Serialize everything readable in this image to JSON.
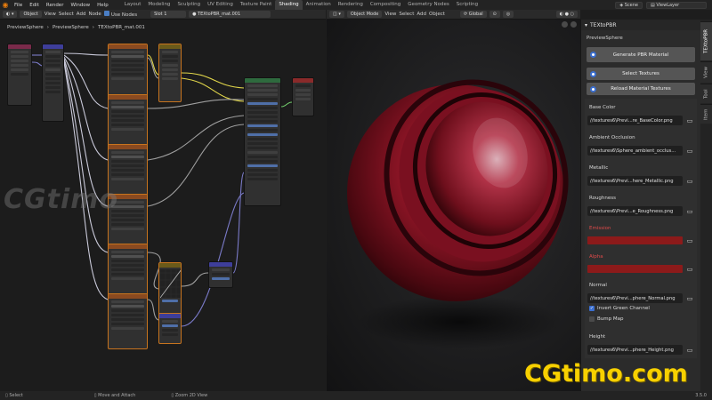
{
  "menu": [
    "File",
    "Edit",
    "Render",
    "Window",
    "Help"
  ],
  "workspaces": [
    "Layout",
    "Modeling",
    "Sculpting",
    "UV Editing",
    "Texture Paint",
    "Shading",
    "Animation",
    "Rendering",
    "Compositing",
    "Geometry Nodes",
    "Scripting"
  ],
  "active_workspace": "Shading",
  "scene": "Scene",
  "view_layer": "ViewLayer",
  "node_header": {
    "mode": "Object",
    "menus": [
      "View",
      "Select",
      "Add",
      "Node"
    ],
    "use_nodes": "Use Nodes",
    "slot": "Slot 1",
    "material": "TEXtoPBR_mat.001"
  },
  "breadcrumb": [
    "PreviewSphere",
    "PreviewSphere",
    "TEXtoPBR_mat.001"
  ],
  "viewport_header": {
    "mode": "Object Mode",
    "menus": [
      "View",
      "Select",
      "Add",
      "Object"
    ],
    "transform": "Global"
  },
  "panel": {
    "title": "TEXtoPBR",
    "object": "PreviewSphere",
    "generate": "Generate PBR Material",
    "select": "Select Textures",
    "reload": "Reload Material Textures",
    "base_color_label": "Base Color",
    "base_color_path": "//textures6\\Previ...re_BaseColor.png",
    "ao_label": "Ambient Occlusion",
    "ao_path": "//textures6\\Sphere_ambient_occlus...",
    "metallic_label": "Metallic",
    "metallic_path": "//textures6\\Previ...here_Metallic.png",
    "roughness_label": "Roughness",
    "roughness_path": "//textures6\\Previ...e_Roughness.png",
    "emission_label": "Emission",
    "alpha_label": "Alpha",
    "normal_label": "Normal",
    "normal_path": "//textures6\\Previ...phere_Normal.png",
    "invert_green": "Invert Green Channel",
    "bump_map": "Bump Map",
    "height_label": "Height",
    "height_path": "//textures6\\Previ...phere_Height.png",
    "swatch_color": "#8c1a1a"
  },
  "side_tabs": [
    "TEXtoPBR",
    "View",
    "Tool",
    "Item"
  ],
  "status": {
    "select": "Select",
    "move": "Move and Attach",
    "zoom": "Zoom 2D View",
    "version": "3.5.0"
  },
  "watermark": {
    "left": "CGtimo",
    "right": "CGtimo.com"
  }
}
